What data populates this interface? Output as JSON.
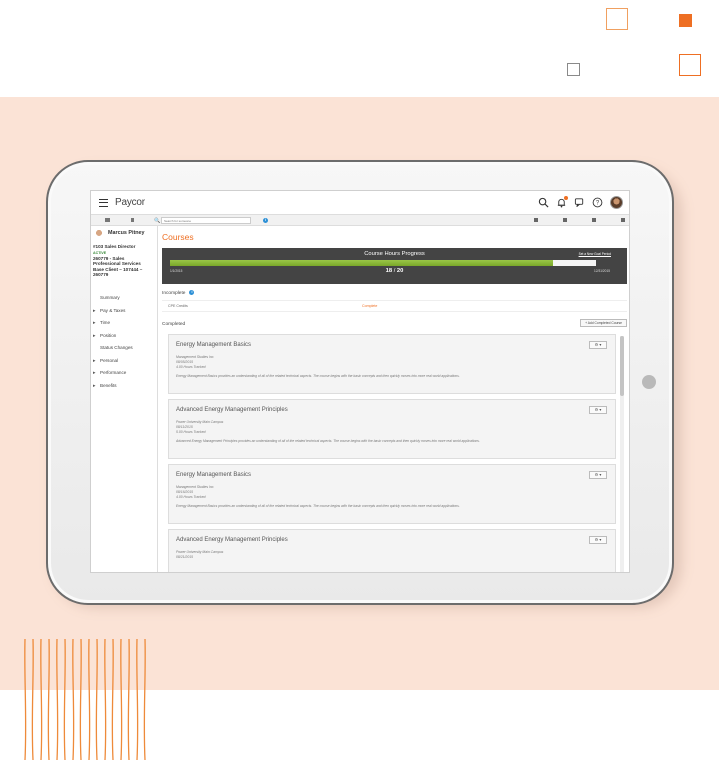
{
  "app": {
    "logo": "Paycor"
  },
  "search": {
    "placeholder": "Search for someone"
  },
  "employee": {
    "name": "Marcus Pitney",
    "title": "#103 Sales Director",
    "status": "ACTIVE",
    "org_lines": [
      "260779 - Sales",
      "Professional Services",
      "Base Client – 107444 –",
      "260779"
    ]
  },
  "sidebar": {
    "items": [
      {
        "label": "Summary",
        "caret": false
      },
      {
        "label": "Pay & Taxes",
        "caret": true
      },
      {
        "label": "Time",
        "caret": true
      },
      {
        "label": "Position",
        "caret": true
      },
      {
        "label": "Status Changes",
        "caret": false
      },
      {
        "label": "Personal",
        "caret": true
      },
      {
        "label": "Performance",
        "caret": true
      },
      {
        "label": "Benefits",
        "caret": true
      }
    ]
  },
  "page": {
    "title": "Courses"
  },
  "progress": {
    "title": "Course Hours Progress",
    "link": "Set a New Goal Period",
    "start_date": "1/1/2015",
    "end_date": "12/31/2015",
    "completed": 18,
    "goal": 20,
    "completed_text": "18",
    "goal_text": "20"
  },
  "incomplete": {
    "heading": "Incomplete",
    "col1": "CPE Credits",
    "col2": "Complete"
  },
  "completed": {
    "heading": "Completed",
    "add_button": "+ Add Completed Course"
  },
  "courses": [
    {
      "title": "Energy Management Basics",
      "provider": "Management Studies Inc.",
      "date": "08/05/2015",
      "hours": "4.00 Hours Tracked",
      "description": "Energy Management Basics provides an understanding of all of the related technical aspects. The course begins with the basic concepts and then quickly moves into more real world applications."
    },
    {
      "title": "Advanced Energy Management Principles",
      "provider": "Power University Main Campus",
      "date": "08/11/2015",
      "hours": "5.00 Hours Tracked",
      "description": "Advanced Energy Management Principles provides an understanding of all of the related technical aspects. The course begins with the basic concepts and then quickly moves into more real world applications."
    },
    {
      "title": "Energy Management Basics",
      "provider": "Management Studies Inc.",
      "date": "08/16/2015",
      "hours": "4.00 Hours Tracked",
      "description": "Energy Management Basics provides an understanding of all of the related technical aspects. The course begins with the basic concepts and then quickly moves into more real world applications."
    },
    {
      "title": "Advanced Energy Management Principles",
      "provider": "Power University Main Campus",
      "date": "08/21/2015",
      "hours": "",
      "description": ""
    }
  ],
  "gear_button": "⚙ ▾",
  "colors": {
    "accent": "#ee6f23",
    "progress_fill": "#8bb83a",
    "panel": "#444444",
    "backdrop": "#fbe3d6"
  }
}
